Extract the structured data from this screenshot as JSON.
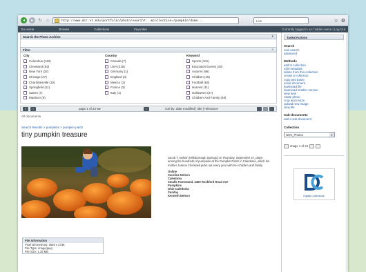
{
  "browser": {
    "address": "http://www.dcr.vt.edu/portfolio/photo/search?...&collection=/pumpkin/dome...",
    "search_placeholder": "Live",
    "nav_glyphs": {
      "back": "◂",
      "forward": "▸",
      "refresh": "↻",
      "home": "⌂"
    }
  },
  "sitenav": {
    "items": [
      "Go Home",
      "Browse",
      "Collections",
      "Favorites"
    ],
    "right": "Currently logged in as: hidden.name | Log Out"
  },
  "search_panel": {
    "title": "Search the Photo Archive",
    "control": "▾"
  },
  "filter_panel": {
    "title": "Filter",
    "control": "»"
  },
  "facets": [
    {
      "title": "City",
      "items": [
        "Columbus (110)",
        "Cleveland (54)",
        "New York (32)",
        "Chicago (27)",
        "Charlottesville (15)",
        "Springfield (11)",
        "Salem (7)",
        "Madison (5)"
      ]
    },
    {
      "title": "Country",
      "items": [
        "Canada (7)",
        "USA (218)",
        "Germany (1)",
        "England (3)",
        "Mexico (2)",
        "France (3)",
        "Italy (1)"
      ]
    },
    {
      "title": "Keyword",
      "items": [
        "Sports (101)",
        "Education Events (43)",
        "Autumn (96)",
        "Children (45)",
        "Football (83)",
        "Harvest (11)",
        "Halloween (27)",
        "Children And Family (48)"
      ]
    }
  ],
  "pager": {
    "info": "page 1 of 23 ◂ ▸",
    "sort": "sort by: date modified | title | relevance",
    "first": "«",
    "prev": "‹",
    "next": "›"
  },
  "result_line": "All documents",
  "record": {
    "breadcrumb": "Search Results > pumpkins > pumpkin patch",
    "title": "tiny pumpkin treasure",
    "description": "Jacob T. Nelson (Hillsborough Springs) on Thursday, September 27, plays among the hundreds of pumpkins at the Pumpkin Patch in Caledonia, which his mother Joanne Clockwell picks out every year with her children and family.",
    "meta": [
      "Online",
      "Caroline Nelson",
      "Caledonia",
      "Smalls Farmstand, 4400 Rockford Road Ave",
      "Pumpkins",
      "Ohio Caledonia",
      "Sunday",
      "Kenneth Nelson"
    ]
  },
  "file_info": {
    "title": "File Information",
    "rows": [
      "Pixel Dimensions: 3648 x 2736",
      "File Type: image/jpeg",
      "File Size: 1.25 MB"
    ]
  },
  "sidebar": {
    "header": "Tasks/Actions",
    "search_title": "Search",
    "search_links": [
      "new search",
      "advanced"
    ],
    "methods_title": "Methods",
    "methods_links": [
      "add to collection",
      "edit metadata",
      "delete from this collection",
      "create a collection",
      "copy and paste",
      "email document",
      "download file",
      "download smaller version",
      "view item",
      "rotate photo",
      "crop and resize",
      "upload new image",
      "view file"
    ],
    "sub_title": "Sub-documents",
    "sub_links": [
      "add a sub-document"
    ],
    "collection_title": "Collection",
    "collection_value": "NHS_Photos",
    "page_label": "image 1 of 23",
    "logo_text": "Digital Collections",
    "colors": {
      "logo_dark": "#1a4c8a",
      "logo_light": "#4aa2d8"
    }
  }
}
